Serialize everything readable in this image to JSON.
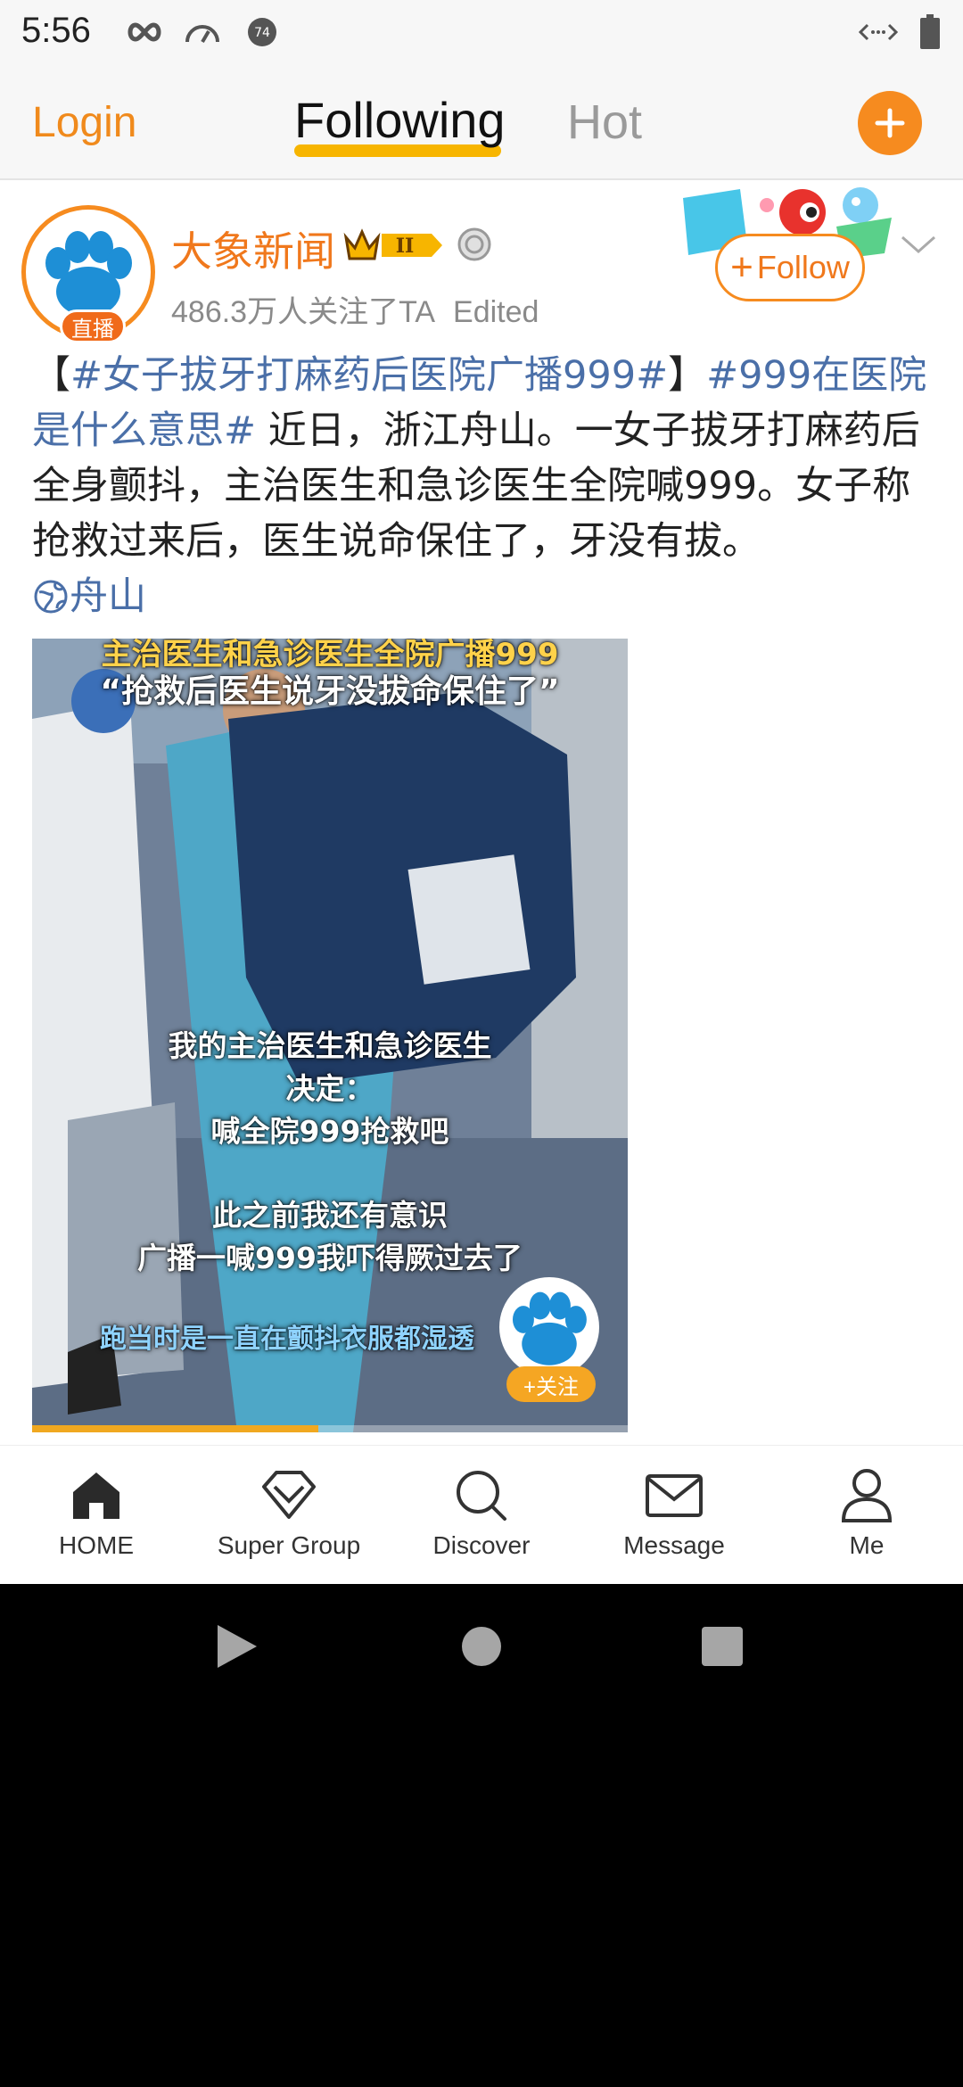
{
  "status_bar": {
    "time": "5:56",
    "icons": [
      "infinity-icon",
      "speedometer-icon",
      "notification-count-icon",
      "code-icon",
      "battery-icon"
    ],
    "notification_count": "74"
  },
  "top_nav": {
    "login": "Login",
    "tabs": [
      {
        "label": "Following",
        "active": true
      },
      {
        "label": "Hot",
        "active": false
      }
    ],
    "accent": "#f68b1f"
  },
  "post": {
    "author": {
      "name": "大象新闻",
      "rank": "II",
      "live_badge": "直播",
      "followers": "486.3万人关注了TA",
      "edited": "Edited"
    },
    "follow_label": "Follow",
    "text": {
      "tag1": "#女子拔牙打麻药后医院广播999#",
      "tag2": "#999在医院是什么意思#",
      "body": "近日，浙江舟山。一女子拔牙打麻药后全身颤抖，主治医生和急诊医生全院喊999。女子称抢救过来后，医生说命保住了，牙没有拔。",
      "location": "舟山"
    },
    "video": {
      "caption_top": "主治医生和急诊医生全院广播999",
      "caption_quote": "“抢救后医生说牙没拔命保住了”",
      "caption_mid_1": "我的主治医生和急诊医生",
      "caption_mid_2": "决定：",
      "caption_mid_3": "喊全院999抢救吧",
      "caption_low_1": "此之前我还有意识",
      "caption_low_2": "广播一喊999我吓得厥过去了",
      "caption_bottom": "跑当时是一直在颤抖衣服都湿透",
      "follow_overlay": "+关注",
      "progress": 0.48
    }
  },
  "tab_bar": [
    {
      "label": "HOME",
      "icon": "home-icon"
    },
    {
      "label": "Super Group",
      "icon": "diamond-icon"
    },
    {
      "label": "Discover",
      "icon": "search-icon"
    },
    {
      "label": "Message",
      "icon": "mail-icon"
    },
    {
      "label": "Me",
      "icon": "person-icon"
    }
  ]
}
